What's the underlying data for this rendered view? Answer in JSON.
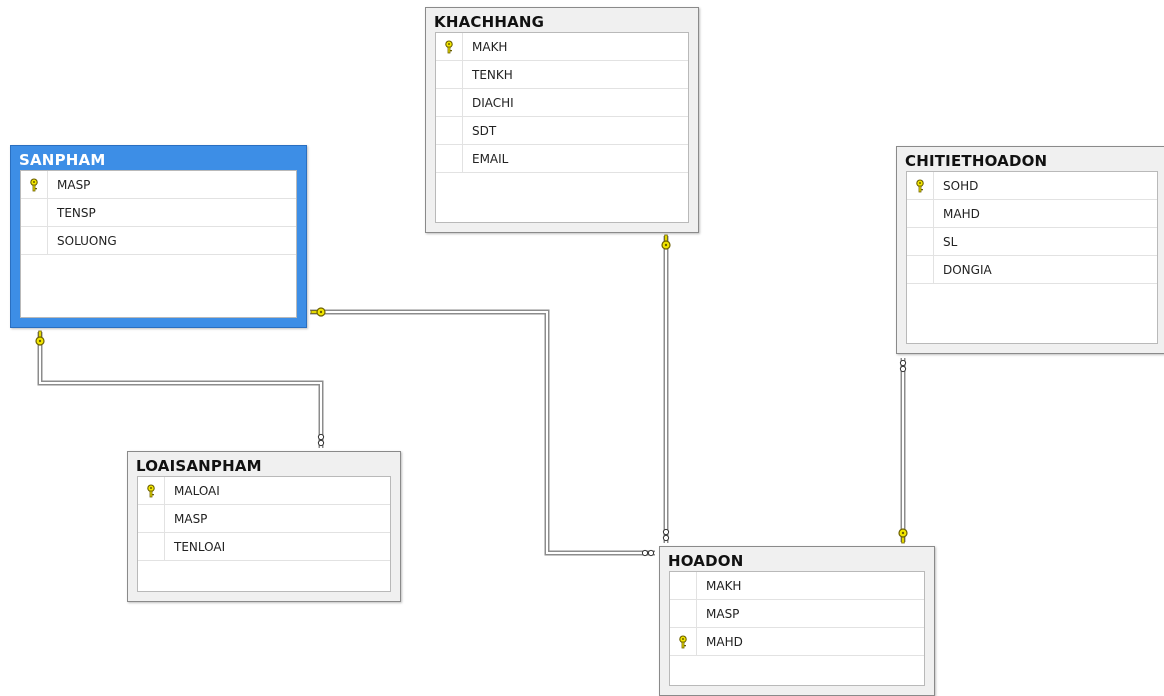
{
  "tables": [
    {
      "id": "khachhang",
      "name": "KHACHHANG",
      "selected": false,
      "columns": [
        {
          "name": "MAKH",
          "pk": true
        },
        {
          "name": "TENKH",
          "pk": false
        },
        {
          "name": "DIACHI",
          "pk": false
        },
        {
          "name": "SDT",
          "pk": false
        },
        {
          "name": "EMAIL",
          "pk": false
        }
      ]
    },
    {
      "id": "sanpham",
      "name": "SANPHAM",
      "selected": true,
      "columns": [
        {
          "name": "MASP",
          "pk": true
        },
        {
          "name": "TENSP",
          "pk": false
        },
        {
          "name": "SOLUONG",
          "pk": false
        }
      ]
    },
    {
      "id": "chitiethoadon",
      "name": "CHITIETHOADON",
      "selected": false,
      "columns": [
        {
          "name": "SOHD",
          "pk": true
        },
        {
          "name": "MAHD",
          "pk": false
        },
        {
          "name": "SL",
          "pk": false
        },
        {
          "name": "DONGIA",
          "pk": false
        }
      ]
    },
    {
      "id": "loaisanpham",
      "name": "LOAISANPHAM",
      "selected": false,
      "columns": [
        {
          "name": "MALOAI",
          "pk": true
        },
        {
          "name": "MASP",
          "pk": false
        },
        {
          "name": "TENLOAI",
          "pk": false
        }
      ]
    },
    {
      "id": "hoadon",
      "name": "HOADON",
      "selected": false,
      "columns": [
        {
          "name": "MAKH",
          "pk": false
        },
        {
          "name": "MASP",
          "pk": false
        },
        {
          "name": "MAHD",
          "pk": true
        }
      ]
    }
  ],
  "relationships": [
    {
      "id": "sanpham-loaisanpham",
      "one": "sanpham",
      "many": "loaisanpham"
    },
    {
      "id": "sanpham-hoadon",
      "one": "sanpham",
      "many": "hoadon"
    },
    {
      "id": "khachhang-hoadon",
      "one": "khachhang",
      "many": "hoadon"
    },
    {
      "id": "hoadon-chitiethoadon",
      "one": "hoadon",
      "many": "chitiethoadon"
    }
  ],
  "colors": {
    "selected_header": "#3d8ee6",
    "key_fill": "#f2e600",
    "key_stroke": "#6b5f00",
    "line": "#8c8c8c"
  }
}
